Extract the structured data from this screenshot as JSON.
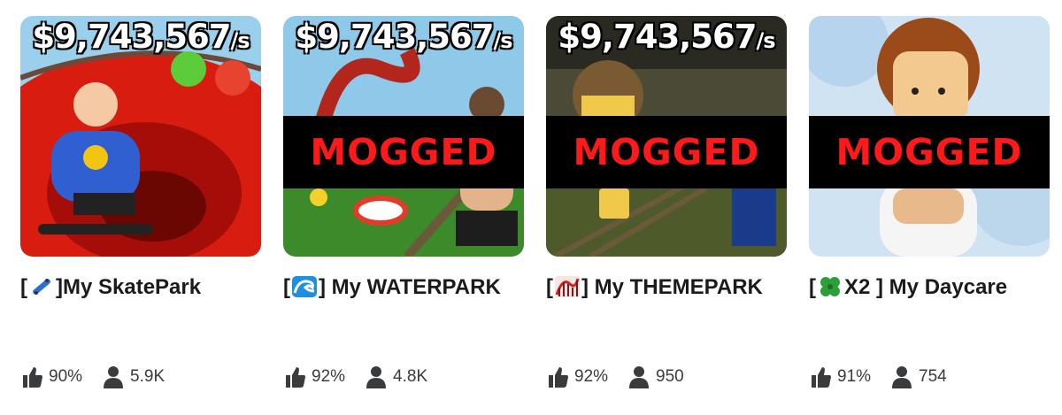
{
  "games": [
    {
      "earnings": "$9,743,567",
      "earnings_unit": "/s",
      "mogged": "",
      "title_prefix": "[",
      "title_emoji": "skateboard-icon",
      "title_text": "]My SkatePark",
      "like_pct": "90%",
      "players": "5.9K"
    },
    {
      "earnings": "$9,743,567",
      "earnings_unit": "/s",
      "mogged": "MOGGED",
      "title_prefix": "[",
      "title_emoji": "wave-icon",
      "title_text": "] My WATERPARK",
      "like_pct": "92%",
      "players": "4.8K"
    },
    {
      "earnings": "$9,743,567",
      "earnings_unit": "/s",
      "mogged": "MOGGED",
      "title_prefix": "[",
      "title_emoji": "rollercoaster-icon",
      "title_text": "] My THEMEPARK",
      "like_pct": "92%",
      "players": "950"
    },
    {
      "earnings": "",
      "earnings_unit": "",
      "mogged": "MOGGED",
      "title_prefix": "[",
      "title_emoji": "four-leaf-clover-icon",
      "title_text": "X2 ] My Daycare",
      "like_pct": "91%",
      "players": "754"
    }
  ],
  "colors": {
    "mogged_text": "#ff1a1a",
    "mogged_band": "#000000",
    "title_text": "#1b1b1b",
    "stat_text": "#393b3d"
  }
}
